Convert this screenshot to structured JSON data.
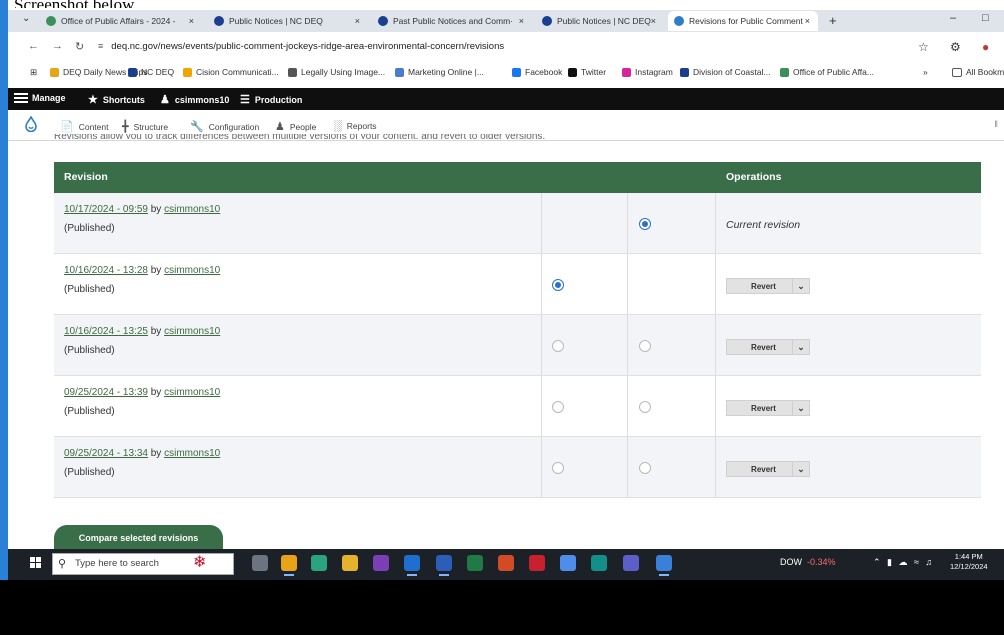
{
  "caption": "Screenshot below.",
  "browser": {
    "tabs": [
      {
        "title": "Office of Public Affairs - 2024 -",
        "favicon_color": "#3a8f5c"
      },
      {
        "title": "Public Notices | NC DEQ",
        "favicon_color": "#1b3f8f"
      },
      {
        "title": "Past Public Notices and Comm·",
        "favicon_color": "#1b3f8f"
      },
      {
        "title": "Public Notices | NC DEQ",
        "favicon_color": "#1b3f8f"
      },
      {
        "title": "Revisions for Public Comment",
        "favicon_color": "#2f7cc9"
      }
    ],
    "active_tab": 4,
    "tab_close": "×",
    "new_tab": "+",
    "window_min": "–",
    "window_max": "□",
    "url": "deq.nc.gov/news/events/public-comment-jockeys-ridge-area-environmental-concern/revisions",
    "bookmarks": [
      {
        "label": "DEQ Daily News Clips",
        "color": "#e8a317"
      },
      {
        "label": "NC DEQ",
        "color": "#1b3f8f"
      },
      {
        "label": "Cision Communicati...",
        "color": "#f0a500"
      },
      {
        "label": "Legally Using Image...",
        "color": "#555555"
      },
      {
        "label": "Marketing Online |...",
        "color": "#4a7bd1"
      },
      {
        "label": "Facebook",
        "color": "#1877f2"
      },
      {
        "label": "Twitter",
        "color": "#111111"
      },
      {
        "label": "Instagram",
        "color": "#d6249f"
      },
      {
        "label": "Division of Coastal...",
        "color": "#1b3f8f"
      },
      {
        "label": "Office of Public Affa...",
        "color": "#3a8f5c"
      }
    ],
    "bookmarks_overflow": "»",
    "all_bookmarks": "All Bookm"
  },
  "admin_toolbar": {
    "manage": "Manage",
    "shortcuts": "Shortcuts",
    "user": "csimmons10",
    "environment": "Production"
  },
  "manage_menu": [
    "Content",
    "Structure",
    "Configuration",
    "People",
    "Reports"
  ],
  "intro_text": "Revisions allow you to track differences between multiple versions of your content, and revert to older versions.",
  "table": {
    "col_revision": "Revision",
    "col_operations": "Operations",
    "by_label": "by",
    "rows": [
      {
        "date": "10/17/2024 - 09:59",
        "author": "csimmons10",
        "status": "(Published)",
        "left_radio": null,
        "right_radio": "checked",
        "operation": "Current revision"
      },
      {
        "date": "10/16/2024 - 13:28",
        "author": "csimmons10",
        "status": "(Published)",
        "left_radio": "checked",
        "right_radio": null,
        "operation": "Revert"
      },
      {
        "date": "10/16/2024 - 13:25",
        "author": "csimmons10",
        "status": "(Published)",
        "left_radio": "unchecked",
        "right_radio": "unchecked",
        "operation": "Revert"
      },
      {
        "date": "09/25/2024 - 13:39",
        "author": "csimmons10",
        "status": "(Published)",
        "left_radio": "unchecked",
        "right_radio": "unchecked",
        "operation": "Revert"
      },
      {
        "date": "09/25/2024 - 13:34",
        "author": "csimmons10",
        "status": "(Published)",
        "left_radio": "unchecked",
        "right_radio": "unchecked",
        "operation": "Revert"
      }
    ]
  },
  "compare_button": "Compare selected revisions",
  "taskbar": {
    "search_placeholder": "Type here to search",
    "ticker": "DOW",
    "ticker_change": "-0.34%",
    "time": "1:44 PM",
    "date": "12/12/2024"
  },
  "colors": {
    "header_green": "#3a6e48",
    "link_green": "#3d6b3f",
    "radio_blue": "#2c6fd1"
  }
}
